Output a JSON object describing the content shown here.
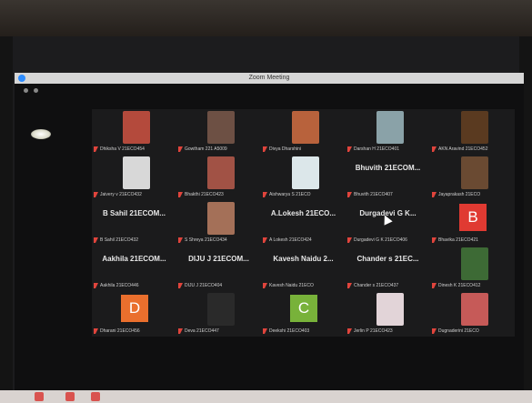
{
  "window": {
    "title": "Zoom Meeting"
  },
  "participants": [
    {
      "label": "Dhiksha V 21ECO454",
      "thumb": "#b44a3c",
      "bigname": ""
    },
    {
      "label": "Gowtham 221 A5009",
      "thumb": "#6d5044",
      "bigname": ""
    },
    {
      "label": "Divya Dharshini",
      "thumb": "#b8623c",
      "bigname": ""
    },
    {
      "label": "Darshan H 21ECO401",
      "thumb": "#8aa2a8",
      "bigname": ""
    },
    {
      "label": "AKN Aravind 21ECO452",
      "thumb": "#5a3a20",
      "bigname": ""
    },
    {
      "label": "Jaivery v 21ECO432",
      "thumb": "#d8d8d8",
      "bigname": ""
    },
    {
      "label": "Bhakthi 21ECO423",
      "thumb": "#a15245",
      "bigname": ""
    },
    {
      "label": "Aishwarya S 21ECO",
      "thumb": "#dce7ea",
      "bigname": ""
    },
    {
      "label": "Bhuvith 21ECO407",
      "thumb": "",
      "bigname": "Bhuvith 21ECOM..."
    },
    {
      "label": "Jayaprakash 21ECO",
      "thumb": "#6a4a32",
      "bigname": ""
    },
    {
      "label": "B Sahil 21ECO432",
      "thumb": "",
      "bigname": "B Sahil 21ECOM..."
    },
    {
      "label": "S Shreya 21ECO434",
      "thumb": "#a47058",
      "bigname": ""
    },
    {
      "label": "A Lokesh 21ECO424",
      "thumb": "",
      "bigname": "A.Lokesh 21ECO..."
    },
    {
      "label": "Durgadevi G K 21ECO406",
      "thumb": "",
      "bigname": "Durgadevi G K..."
    },
    {
      "label": "Bhavika 21ECO421",
      "thumb": "#e03a32",
      "avatar": "B",
      "bigname": ""
    },
    {
      "label": "Aakhila 21ECO446",
      "thumb": "",
      "bigname": "Aakhila 21ECOM..."
    },
    {
      "label": "DIJU J 21ECO404",
      "thumb": "",
      "bigname": "DIJU J 21ECOM..."
    },
    {
      "label": "Kavesh Naidu 21ECO",
      "thumb": "",
      "bigname": "Kavesh Naidu 2..."
    },
    {
      "label": "Chander s 21ECO437",
      "thumb": "",
      "bigname": "Chander s 21EC..."
    },
    {
      "label": "Dinesh K 21ECO412",
      "thumb": "#3d6a35",
      "bigname": ""
    },
    {
      "label": "Dharani 21ECO456",
      "thumb": "#ea6f2d",
      "avatar": "D",
      "bigname": ""
    },
    {
      "label": "Deva 21ECO447",
      "thumb": "#2a2a2a",
      "bigname": ""
    },
    {
      "label": "Deekshi 21ECO403",
      "thumb": "#78b23a",
      "avatar": "C",
      "bigname": ""
    },
    {
      "label": "Jerlin P 21ECO423",
      "thumb": "#e2d4d8",
      "bigname": ""
    },
    {
      "label": "Dugnaderini 21ECO",
      "thumb": "#c65a58",
      "bigname": ""
    }
  ]
}
